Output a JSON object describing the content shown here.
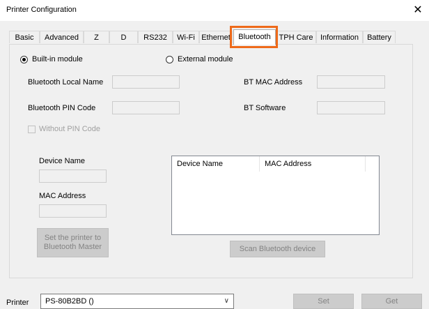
{
  "window": {
    "title": "Printer Configuration",
    "close_glyph": "✕"
  },
  "tabs": [
    "Basic",
    "Advanced",
    "Z",
    "D",
    "RS232",
    "Wi-Fi",
    "Ethernet",
    "Bluetooth",
    "TPH Care",
    "Information",
    "Battery"
  ],
  "active_tab": "Bluetooth",
  "highlight_color": "#ee6a1a",
  "bluetooth": {
    "radio_builtin": "Built-in module",
    "radio_external": "External module",
    "local_name_label": "Bluetooth Local Name",
    "pin_code_label": "Bluetooth PIN Code",
    "mac_address_label": "BT MAC Address",
    "software_label": "BT Software",
    "without_pin_label": "Without PIN Code",
    "device_name_label": "Device Name",
    "mac_label": "MAC Address",
    "set_master_line1": "Set the printer to",
    "set_master_line2": "Bluetooth Master",
    "list_columns": [
      "Device Name",
      "MAC Address",
      ""
    ],
    "scan_button": "Scan Bluetooth device"
  },
  "bottom": {
    "printer_label": "Printer",
    "printer_value": "PS-80B2BD ()",
    "set_button": "Set",
    "get_button": "Get"
  }
}
